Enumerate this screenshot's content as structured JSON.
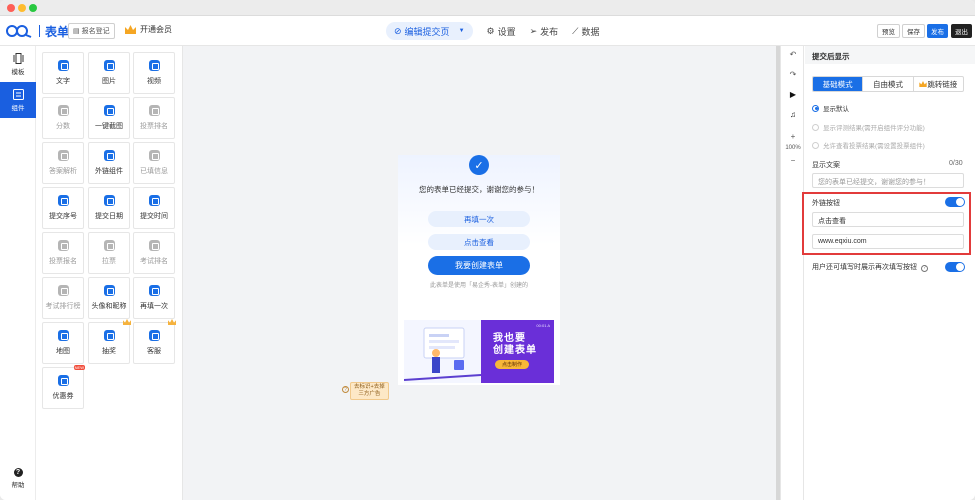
{
  "topbar": {
    "logo_text": "表单",
    "report_btn": "报名登记",
    "vip_label": "开通会员",
    "tabs": [
      {
        "label": "编辑提交页"
      },
      {
        "label": "设置"
      },
      {
        "label": "发布"
      },
      {
        "label": "数据"
      }
    ],
    "actions": {
      "preview": "预览",
      "save": "保存",
      "publish": "发布",
      "exit": "退出"
    }
  },
  "rail": {
    "items": [
      {
        "label": "模板"
      },
      {
        "label": "组件"
      }
    ],
    "help_label": "帮助"
  },
  "components": [
    {
      "label": "文字",
      "disabled": false
    },
    {
      "label": "图片",
      "disabled": false
    },
    {
      "label": "视频",
      "disabled": false
    },
    {
      "label": "分数",
      "disabled": true
    },
    {
      "label": "一键截图",
      "disabled": false
    },
    {
      "label": "投票排名",
      "disabled": true
    },
    {
      "label": "答案解析",
      "disabled": true
    },
    {
      "label": "外链组件",
      "disabled": false
    },
    {
      "label": "已填信息",
      "disabled": true
    },
    {
      "label": "提交序号",
      "disabled": false
    },
    {
      "label": "提交日期",
      "disabled": false
    },
    {
      "label": "提交时间",
      "disabled": false
    },
    {
      "label": "投票报名",
      "disabled": true
    },
    {
      "label": "拉票",
      "disabled": true
    },
    {
      "label": "考试排名",
      "disabled": true
    },
    {
      "label": "考试排行榜",
      "disabled": true
    },
    {
      "label": "头像和昵称",
      "disabled": false
    },
    {
      "label": "再填一次",
      "disabled": false
    },
    {
      "label": "地图",
      "disabled": false
    },
    {
      "label": "抽奖",
      "disabled": false,
      "badge": "crown"
    },
    {
      "label": "客服",
      "disabled": false,
      "badge": "crown"
    },
    {
      "label": "优惠券",
      "disabled": false,
      "badge": "new"
    }
  ],
  "toolbar": {
    "zoom": "100%"
  },
  "form": {
    "thanks": "您的表单已经提交，谢谢您的参与！",
    "refill": "再填一次",
    "view": "点击查看",
    "create": "我要创建表单",
    "notice": "此表单是使用「易企秀-表单」创建的",
    "banner_title_1": "我也要",
    "banner_title_2": "创建表单",
    "banner_btn": "点击制作",
    "banner_date": "00:01 A"
  },
  "note_tag": "去标识+去掉\n三方广告",
  "right_panel": {
    "header": "提交后显示",
    "modes": [
      {
        "label": "基础模式",
        "active": true
      },
      {
        "label": "自由模式",
        "active": false
      },
      {
        "label": "跳转链接",
        "active": false
      }
    ],
    "options": [
      {
        "label": "显示默认",
        "checked": true,
        "disabled": false
      },
      {
        "label": "显示评测结果(需开启组件评分功能)",
        "checked": false,
        "disabled": true
      },
      {
        "label": "允许查看投票结果(需设置投票组件)",
        "checked": false,
        "disabled": true
      }
    ],
    "text_label": "显示文案",
    "text_count": "0/30",
    "text_placeholder": "您的表单已经提交，谢谢您的参与！",
    "link_btn_label": "外链按钮",
    "link_btn_text": "点击查看",
    "link_url": "www.eqxiu.com",
    "refill_label": "用户还可填写时展示再次填写按钮"
  },
  "colors": {
    "accent": "#1a6fe6",
    "highlight": "#e23b3b"
  }
}
